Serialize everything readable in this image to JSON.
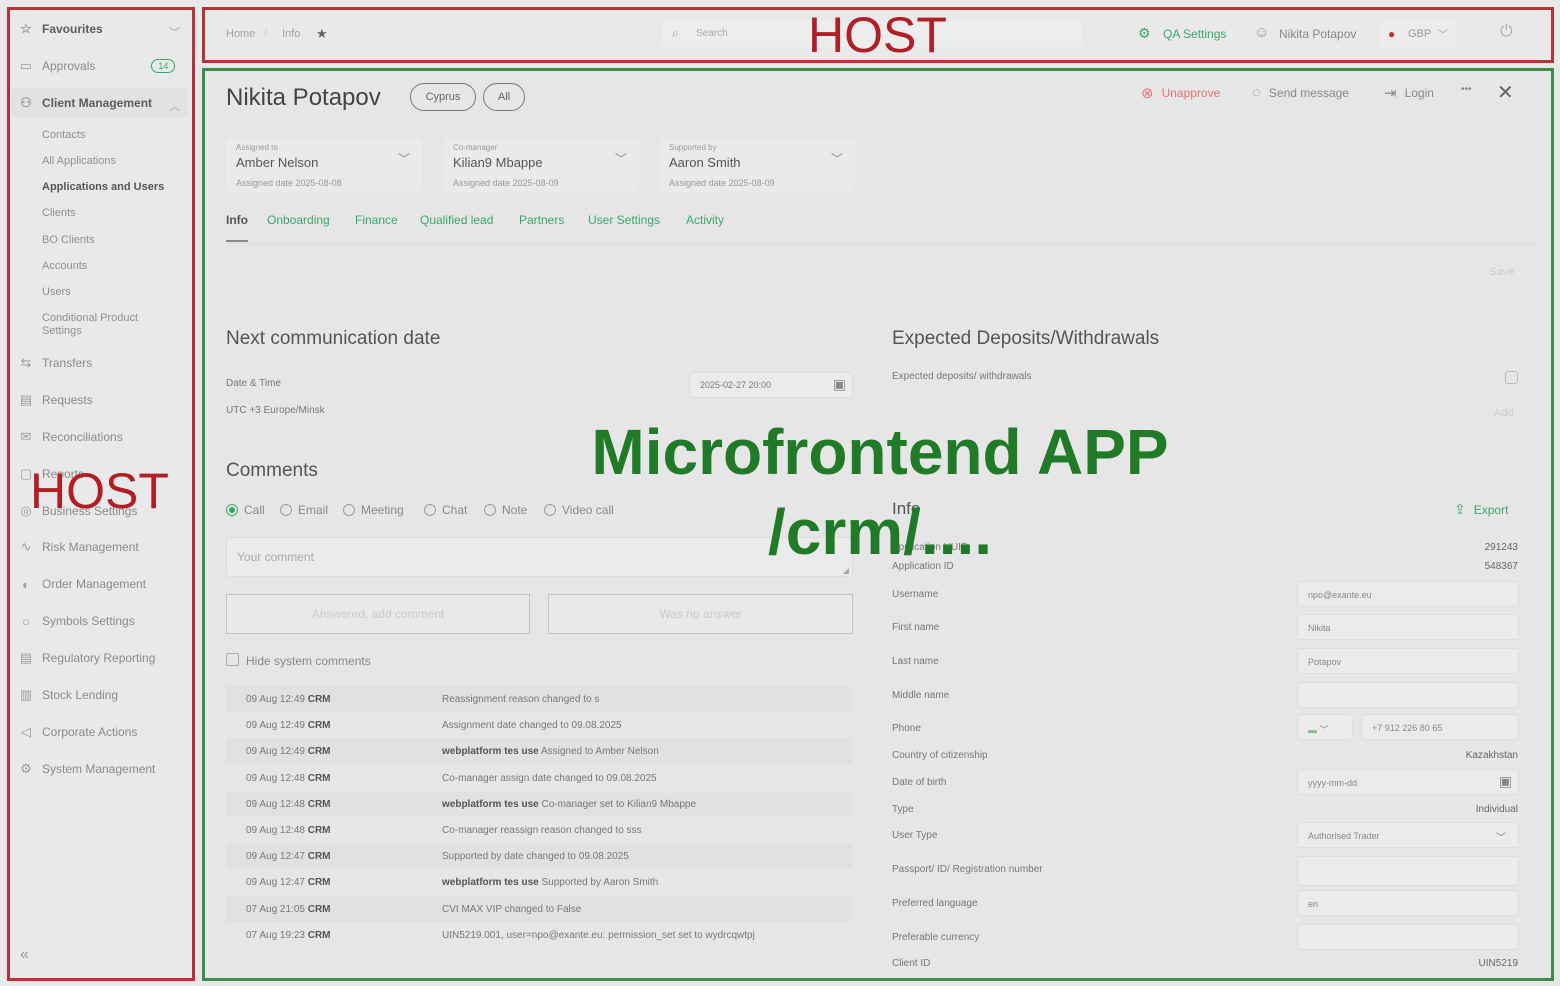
{
  "overlay": {
    "host_top": "HOST",
    "host_left": "HOST",
    "mf_line1": "Microfrontend APP",
    "mf_line2": "/crm/....",
    "host_color": "#b01e26",
    "mf_color": "#217a28"
  },
  "sidebar": {
    "items": [
      {
        "label": "Favourites",
        "icon": "star-icon"
      },
      {
        "label": "Approvals",
        "icon": "approvals-icon",
        "badge": "14"
      },
      {
        "label": "Client Management",
        "icon": "users-icon"
      }
    ],
    "sub": [
      "Contacts",
      "All Applications",
      "Applications and Users",
      "Clients",
      "BO Clients",
      "Accounts",
      "Users",
      "Conditional Product Settings"
    ],
    "rest": [
      "Transfers",
      "Requests",
      "Reconciliations",
      "Reports",
      "Business Settings",
      "Risk Management",
      "Order Management",
      "Symbols Settings",
      "Regulatory Reporting",
      "Stock Lending",
      "Corporate Actions",
      "System Management"
    ],
    "collapse": "«"
  },
  "topbar": {
    "breadcrumb_home": "Home",
    "breadcrumb_info": "Info",
    "search_placeholder": "Search",
    "qa_settings": "QA Settings",
    "user": "Nikita Potapov",
    "currency": "GBP"
  },
  "client": {
    "name": "Nikita Potapov",
    "pill1": "Cyprus",
    "pill2": "All",
    "unapprove": "Unapprove",
    "send_message": "Send message",
    "login": "Login",
    "more": "•••"
  },
  "assignments": [
    {
      "label": "Assigned to",
      "value": "Amber Nelson",
      "date": "Assigned date 2025-08-08"
    },
    {
      "label": "Co-manager",
      "value": "Kilian9 Mbappe",
      "date": "Assigned date 2025-08-09"
    },
    {
      "label": "Supported by",
      "value": "Aaron Smith",
      "date": "Assigned date 2025-08-09"
    }
  ],
  "tabs": [
    "Info",
    "Onboarding",
    "Finance",
    "Qualified lead",
    "Partners",
    "User Settings",
    "Activity"
  ],
  "save_label": "Save",
  "next_comm": {
    "title": "Next communication date",
    "dt_label": "Date & Time",
    "dt_value": "2025-02-27 20:00",
    "tz": "UTC +3 Europe/Minsk"
  },
  "deposits": {
    "title": "Expected Deposits/Withdrawals",
    "label": "Expected deposits/ withdrawals",
    "add": "Add"
  },
  "comments": {
    "title": "Comments",
    "types": [
      "Call",
      "Email",
      "Meeting",
      "Chat",
      "Note",
      "Video call"
    ],
    "placeholder": "Your comment",
    "btn_answered": "Answered, add comment",
    "btn_no_answer": "Was no answer",
    "hide_system": "Hide system comments",
    "rows": [
      {
        "time": "09 Aug 12:49",
        "src": "CRM",
        "who": "",
        "msg": "Reassignment reason changed to s"
      },
      {
        "time": "09 Aug 12:49",
        "src": "CRM",
        "who": "",
        "msg": "Assignment date changed to 09.08.2025"
      },
      {
        "time": "09 Aug 12:49",
        "src": "CRM",
        "who": "webplatform tes use",
        "msg": "Assigned to Amber Nelson"
      },
      {
        "time": "09 Aug 12:48",
        "src": "CRM",
        "who": "",
        "msg": "Co-manager assign date changed to 09.08.2025"
      },
      {
        "time": "09 Aug 12:48",
        "src": "CRM",
        "who": "webplatform tes use",
        "msg": "Co-manager set to Kilian9 Mbappe"
      },
      {
        "time": "09 Aug 12:48",
        "src": "CRM",
        "who": "",
        "msg": "Co-manager reassign reason changed to sss"
      },
      {
        "time": "09 Aug 12:47",
        "src": "CRM",
        "who": "",
        "msg": "Supported by date changed to 09.08.2025"
      },
      {
        "time": "09 Aug 12:47",
        "src": "CRM",
        "who": "webplatform tes use",
        "msg": "Supported by Aaron Smith"
      },
      {
        "time": "07 Aug 21:05",
        "src": "CRM",
        "who": "",
        "msg": "CVI MAX VIP changed to False"
      },
      {
        "time": "07 Aug 19:23",
        "src": "CRM",
        "who": "",
        "msg": "UIN5219.001, user=npo@exante.eu: permission_set set to wydrcqwtpj"
      }
    ]
  },
  "info": {
    "title": "Info",
    "export": "Export",
    "fields": [
      {
        "label": "Application UUID",
        "value": "291243",
        "kind": "text"
      },
      {
        "label": "Application ID",
        "value": "548367",
        "kind": "text"
      },
      {
        "label": "Username",
        "value": "npo@exante.eu",
        "kind": "input"
      },
      {
        "label": "First name",
        "value": "Nikita",
        "kind": "input"
      },
      {
        "label": "Last name",
        "value": "Potapov",
        "kind": "input"
      },
      {
        "label": "Middle name",
        "value": "",
        "kind": "input"
      },
      {
        "label": "Phone",
        "value": "+7 912 226 80 65",
        "kind": "phone"
      },
      {
        "label": "Country of citizenship",
        "value": "Kazakhstan",
        "kind": "text"
      },
      {
        "label": "Date of birth",
        "value": "yyyy-mm-dd",
        "kind": "date"
      },
      {
        "label": "Type",
        "value": "Individual",
        "kind": "text"
      },
      {
        "label": "User Type",
        "value": "Authorised Trader",
        "kind": "select"
      },
      {
        "label": "Passport/ ID/ Registration number",
        "value": "",
        "kind": "textarea"
      },
      {
        "label": "Preferred language",
        "value": "en",
        "kind": "input"
      },
      {
        "label": "Preferable currency",
        "value": "",
        "kind": "input"
      },
      {
        "label": "Client ID",
        "value": "UIN5219",
        "kind": "text"
      }
    ]
  }
}
